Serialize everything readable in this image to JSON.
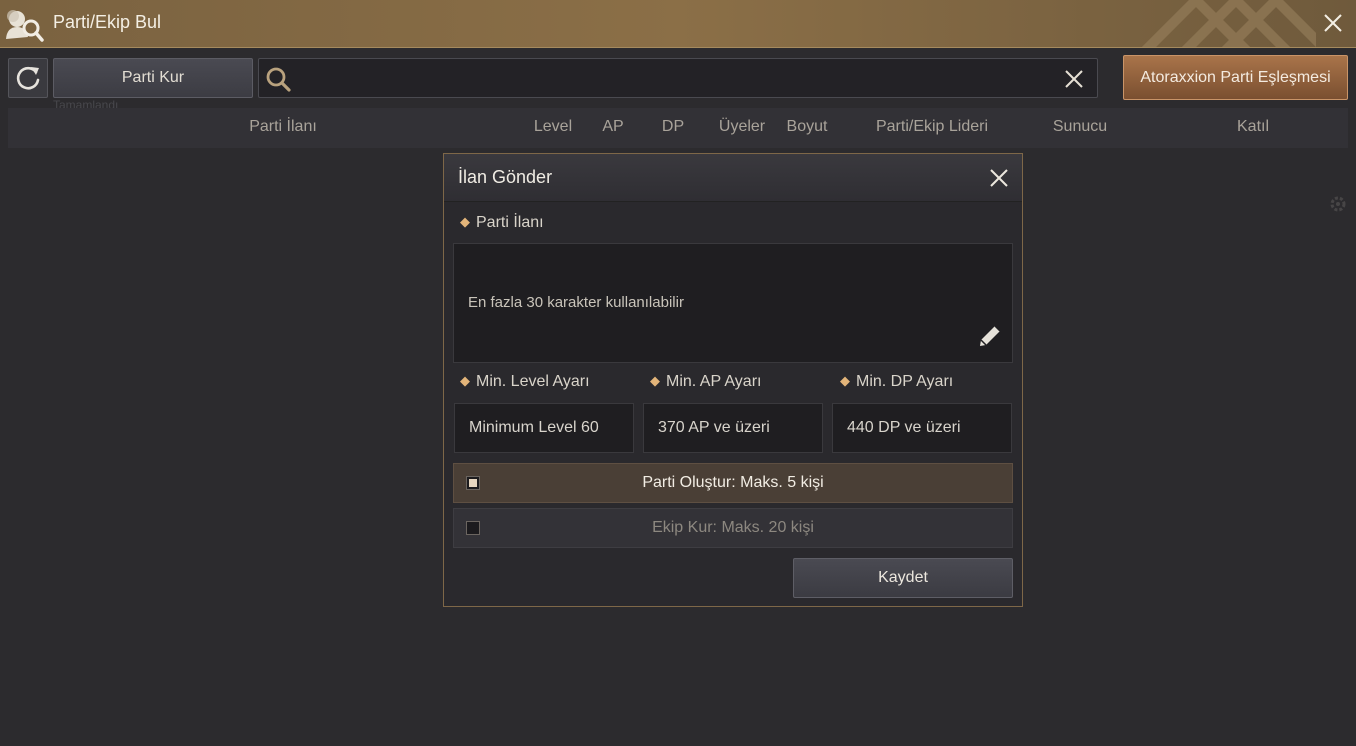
{
  "window": {
    "title": "Parti/Ekip Bul",
    "title_icon": "party-search-icon",
    "close_icon": "close-icon"
  },
  "toolbar": {
    "refresh_icon": "refresh-icon",
    "create_label": "Parti Kur",
    "ghost_text": "Tamamlandı",
    "search": {
      "value": "",
      "placeholder": ""
    },
    "match_label": "Atoraxxion Parti Eşleşmesi"
  },
  "columns": [
    "Parti İlanı",
    "Level",
    "AP",
    "DP",
    "Üyeler",
    "Boyut",
    "Parti/Ekip Lideri",
    "Sunucu",
    "Katıl"
  ],
  "dialog": {
    "title": "İlan Gönder",
    "ad_label": "Parti İlanı",
    "ad_placeholder": "En fazla 30 karakter kullanılabilir",
    "min_level_label": "Min. Level Ayarı",
    "min_ap_label": "Min. AP Ayarı",
    "min_dp_label": "Min. DP Ayarı",
    "min_level_value": "Minimum Level 60",
    "min_ap_value": "370 AP ve üzeri",
    "min_dp_value": "440 DP ve üzeri",
    "party_option": "Parti Oluştur: Maks. 5 kişi",
    "squad_option": "Ekip Kur: Maks. 20 kişi",
    "party_selected": true,
    "save_label": "Kaydet"
  },
  "colors": {
    "titlebar": "#8b6f47",
    "accent": "#e3b57a",
    "match_button": "#a9744a",
    "background": "#2c2b2e"
  }
}
